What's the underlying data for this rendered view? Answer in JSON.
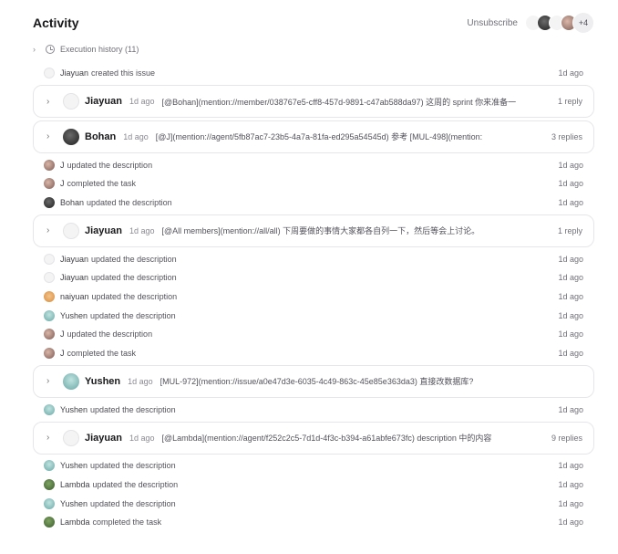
{
  "header": {
    "title": "Activity",
    "unsubscribe_label": "Unsubscribe",
    "subscribers_more": "+4"
  },
  "execution_history": {
    "label": "Execution history (11)"
  },
  "feed": [
    {
      "kind": "activity",
      "actor": "Jiayuan",
      "avatar": "jiayuan",
      "text": "created this issue",
      "time": "1d ago"
    },
    {
      "kind": "thread",
      "author": "Jiayuan",
      "avatar": "jiayuan",
      "time": "1d ago",
      "preview": "[@Bohan](mention://member/038767e5-cff8-457d-9891-c47ab588da97) 这周的 sprint 你来准备一",
      "replies": "1 reply"
    },
    {
      "kind": "thread",
      "author": "Bohan",
      "avatar": "bohan",
      "time": "1d ago",
      "preview": "[@J](mention://agent/5fb87ac7-23b5-4a7a-81fa-ed295a54545d) 参考 [MUL-498](mention:",
      "replies": "3 replies"
    },
    {
      "kind": "activity",
      "actor": "J",
      "avatar": "j",
      "text": "updated the description",
      "time": "1d ago"
    },
    {
      "kind": "activity",
      "actor": "J",
      "avatar": "j",
      "text": "completed the task",
      "time": "1d ago"
    },
    {
      "kind": "activity",
      "actor": "Bohan",
      "avatar": "bohan",
      "text": "updated the description",
      "time": "1d ago"
    },
    {
      "kind": "thread",
      "author": "Jiayuan",
      "avatar": "jiayuan",
      "time": "1d ago",
      "preview": "[@All members](mention://all/all) 下周要做的事情大家都各自列一下，然后等会上讨论。",
      "replies": "1 reply"
    },
    {
      "kind": "activity",
      "actor": "Jiayuan",
      "avatar": "jiayuan",
      "text": "updated the description",
      "time": "1d ago"
    },
    {
      "kind": "activity",
      "actor": "Jiayuan",
      "avatar": "jiayuan",
      "text": "updated the description",
      "time": "1d ago"
    },
    {
      "kind": "activity",
      "actor": "naiyuan",
      "avatar": "naiyuan",
      "text": "updated the description",
      "time": "1d ago"
    },
    {
      "kind": "activity",
      "actor": "Yushen",
      "avatar": "yushen",
      "text": "updated the description",
      "time": "1d ago"
    },
    {
      "kind": "activity",
      "actor": "J",
      "avatar": "j",
      "text": "updated the description",
      "time": "1d ago"
    },
    {
      "kind": "activity",
      "actor": "J",
      "avatar": "j",
      "text": "completed the task",
      "time": "1d ago"
    },
    {
      "kind": "thread",
      "author": "Yushen",
      "avatar": "yushen",
      "time": "1d ago",
      "preview": "[MUL-972](mention://issue/a0e47d3e-6035-4c49-863c-45e85e363da3) 直接改数据库?",
      "replies": ""
    },
    {
      "kind": "activity",
      "actor": "Yushen",
      "avatar": "yushen",
      "text": "updated the description",
      "time": "1d ago"
    },
    {
      "kind": "thread",
      "author": "Jiayuan",
      "avatar": "jiayuan",
      "time": "1d ago",
      "preview": "[@Lambda](mention://agent/f252c2c5-7d1d-4f3c-b394-a61abfe673fc) description 中的内容",
      "replies": "9 replies"
    },
    {
      "kind": "activity",
      "actor": "Yushen",
      "avatar": "yushen",
      "text": "updated the description",
      "time": "1d ago"
    },
    {
      "kind": "activity",
      "actor": "Lambda",
      "avatar": "lambda",
      "text": "updated the description",
      "time": "1d ago"
    },
    {
      "kind": "activity",
      "actor": "Yushen",
      "avatar": "yushen",
      "text": "updated the description",
      "time": "1d ago"
    },
    {
      "kind": "activity",
      "actor": "Lambda",
      "avatar": "lambda",
      "text": "completed the task",
      "time": "1d ago"
    }
  ]
}
